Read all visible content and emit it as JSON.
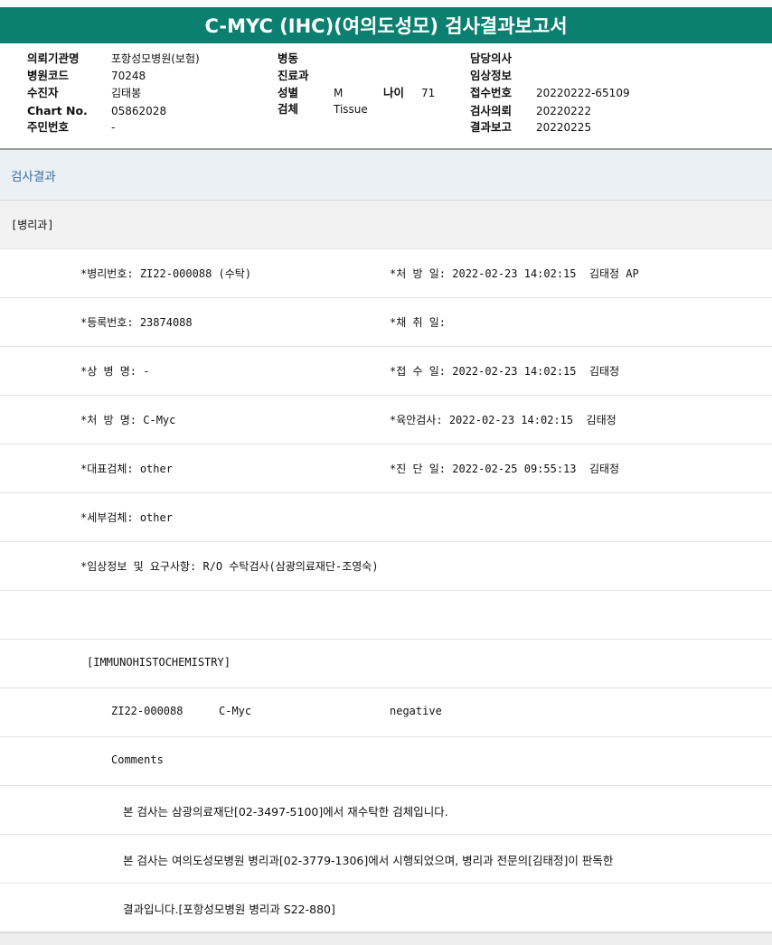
{
  "report": {
    "title": "C-MYC (IHC)(여의도성모) 검사결과보고서"
  },
  "patient": {
    "institution_label": "의뢰기관명",
    "institution": "포항성모병원(보험)",
    "hospital_code_label": "병원코드",
    "hospital_code": "70248",
    "recipient_label": "수진자",
    "recipient": "김태봉",
    "chart_no_label": "Chart No.",
    "chart_no": "05862028",
    "resident_no_label": "주민번호",
    "resident_no": "-",
    "ward_label": "병동",
    "ward": "",
    "department_label": "진료과",
    "department": "",
    "sex_label": "성별",
    "sex": "M",
    "age_label": "나이",
    "age": "71",
    "specimen_label": "검체",
    "specimen": "Tissue",
    "doctor_label": "담당의사",
    "doctor": "",
    "clinical_info_label": "임상정보",
    "clinical_info": "",
    "receipt_no_label": "접수번호",
    "receipt_no": "20220222-65109",
    "test_request_label": "검사의뢰",
    "test_request": "20220222",
    "result_report_label": "결과보고",
    "result_report": "20220225"
  },
  "results": {
    "section_title": "검사결과",
    "department": "[병리과]",
    "pathology_no": "*병리번호: ZI22-000088 (수탁)",
    "order_date": "*처 방 일: 2022-02-23 14:02:15  김태정 AP",
    "registration_no": "*등록번호: 23874088",
    "collection_date": "*채 취 일:",
    "disease_name": "*상 병 명: -",
    "receipt_date": "*접 수 일: 2022-02-23 14:02:15  김태정",
    "order_name": "*처 방 명: C-Myc",
    "gross_exam": "*육안검사: 2022-02-23 14:02:15  김태정",
    "main_specimen": "*대표검체: other",
    "diagnosis_date": "*진 단 일: 2022-02-25 09:55:13  김태정",
    "sub_specimen": "*세부검체: other",
    "clinical_request": "*임상정보 및 요구사항: R/O 수탁검사(삼광의료재단-조영숙)",
    "ihc_header": "[IMMUNOHISTOCHEMISTRY]",
    "ihc_case": "ZI22-000088",
    "ihc_marker": "C-Myc",
    "ihc_result": "negative",
    "comments_label": "Comments",
    "comment_1": "본 검사는 삼광의료재단[02-3497-5100]에서 재수탁한 검체입니다.",
    "comment_2": "본 검사는 여의도성모병원 병리과[02-3779-1306]에서 시행되었으며, 병리과 전문의[김태정]이 판독한",
    "comment_3": "결과입니다.[포항성모병원 병리과 S22-880]"
  }
}
